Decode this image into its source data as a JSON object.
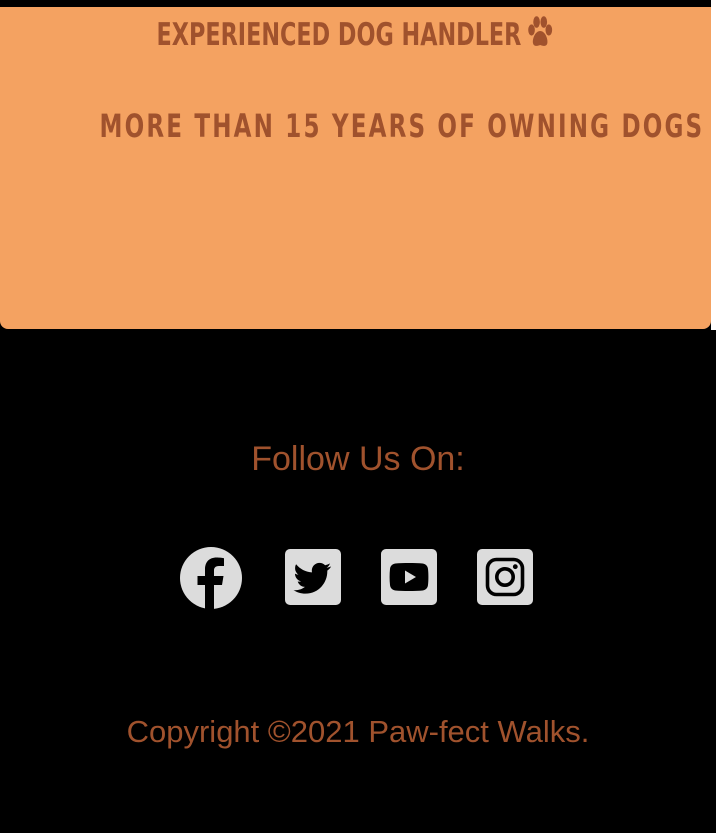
{
  "hero": {
    "title": "Experienced Dog Handler",
    "title_icon": "paw-icon",
    "subtitle": "More than 15 years of owning dogs"
  },
  "footer": {
    "heading": "Follow Us On:",
    "socials": [
      {
        "name": "facebook",
        "icon": "facebook-icon"
      },
      {
        "name": "twitter",
        "icon": "twitter-icon"
      },
      {
        "name": "youtube",
        "icon": "youtube-icon"
      },
      {
        "name": "instagram",
        "icon": "instagram-icon"
      }
    ],
    "copyright": "Copyright ©2021 Paw-fect Walks."
  },
  "colors": {
    "card_background": "#f4a261",
    "accent_text": "#a0522d",
    "page_background": "#000000",
    "icon_fill": "#dcdcdc"
  }
}
